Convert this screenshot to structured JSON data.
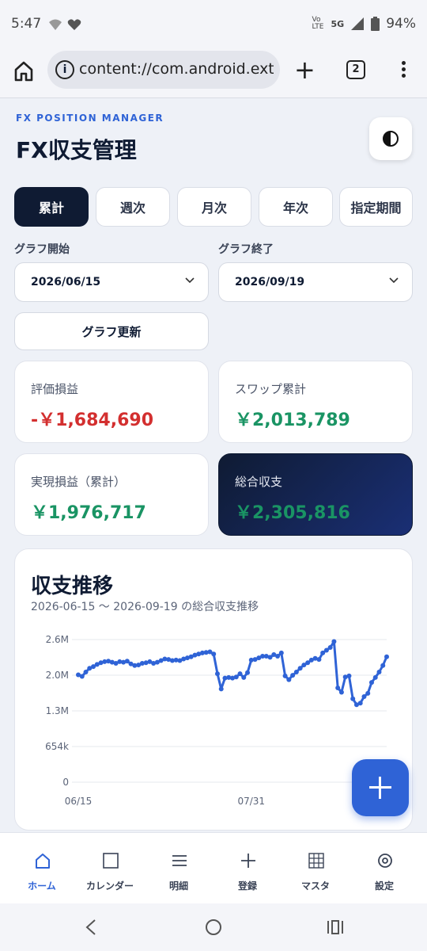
{
  "status_bar": {
    "time": "5:47",
    "battery": "94%",
    "network": "5G",
    "volte": "Vo LTE"
  },
  "browser": {
    "url": "content://com.android.exter",
    "tab_count": "2"
  },
  "app": {
    "subtitle": "FX POSITION MANAGER",
    "title": "FX収支管理"
  },
  "period_tabs": [
    {
      "label": "累計",
      "active": true
    },
    {
      "label": "週次",
      "active": false
    },
    {
      "label": "月次",
      "active": false
    },
    {
      "label": "年次",
      "active": false
    },
    {
      "label": "指定期間",
      "active": false
    }
  ],
  "range": {
    "start_label": "グラフ開始",
    "start_value": "2026/06/15",
    "end_label": "グラフ終了",
    "end_value": "2026/09/19",
    "update_label": "グラフ更新"
  },
  "kpis": {
    "unrealized": {
      "label": "評価損益",
      "value": "-￥1,684,690"
    },
    "swap": {
      "label": "スワップ累計",
      "value": "￥2,013,789"
    },
    "realized": {
      "label": "実現損益（累計）",
      "value": "￥1,976,717"
    },
    "total": {
      "label": "総合収支",
      "value": "￥2,305,816"
    }
  },
  "chart_panel": {
    "title": "収支推移",
    "subtitle": "2026-06-15 〜 2026-09-19 の総合収支推移"
  },
  "chart_data": {
    "type": "line",
    "y_ticks": [
      "2.6M",
      "2.0M",
      "1.3M",
      "654k",
      "0"
    ],
    "y_tick_values": [
      2616000,
      1962000,
      1308000,
      654000,
      0
    ],
    "ylim": [
      0,
      2616000
    ],
    "x_ticks": [
      "06/15",
      "07/31"
    ],
    "x_tick_index": [
      0,
      46
    ],
    "grid": true,
    "color": "#2f63d6",
    "values": [
      1970000,
      1940000,
      2020000,
      2090000,
      2120000,
      2160000,
      2190000,
      2210000,
      2220000,
      2200000,
      2180000,
      2210000,
      2200000,
      2220000,
      2170000,
      2140000,
      2150000,
      2180000,
      2190000,
      2210000,
      2180000,
      2200000,
      2230000,
      2260000,
      2250000,
      2230000,
      2240000,
      2230000,
      2260000,
      2280000,
      2300000,
      2330000,
      2350000,
      2370000,
      2380000,
      2390000,
      2350000,
      1990000,
      1710000,
      1910000,
      1920000,
      1910000,
      1930000,
      1990000,
      1920000,
      2010000,
      2240000,
      2250000,
      2280000,
      2310000,
      2310000,
      2290000,
      2340000,
      2310000,
      2370000,
      1950000,
      1880000,
      1960000,
      2020000,
      2090000,
      2150000,
      2190000,
      2240000,
      2270000,
      2250000,
      2370000,
      2420000,
      2470000,
      2580000,
      1730000,
      1650000,
      1930000,
      1950000,
      1530000,
      1420000,
      1450000,
      1570000,
      1630000,
      1830000,
      1920000,
      2020000,
      2140000,
      2300000
    ],
    "dates": {
      "start": "2026-06-15",
      "end": "2026-09-19"
    }
  },
  "bottom_nav": [
    {
      "label": "ホーム",
      "active": true
    },
    {
      "label": "カレンダー",
      "active": false
    },
    {
      "label": "明細",
      "active": false
    },
    {
      "label": "登録",
      "active": false
    },
    {
      "label": "マスタ",
      "active": false
    },
    {
      "label": "設定",
      "active": false
    }
  ],
  "colors": {
    "accent": "#2f63d6",
    "dark": "#0f1b33",
    "negative": "#d32f2f",
    "positive": "#1a9464"
  }
}
